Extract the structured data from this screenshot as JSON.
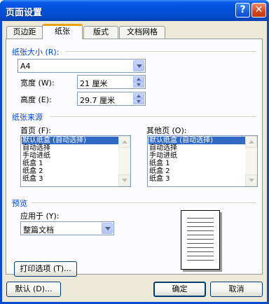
{
  "window": {
    "title": "页面设置",
    "help_glyph": "?",
    "close_glyph": "✕"
  },
  "tabs": [
    {
      "label": "页边距"
    },
    {
      "label": "纸张"
    },
    {
      "label": "版式"
    },
    {
      "label": "文档网格"
    }
  ],
  "paper_size": {
    "heading": "纸张大小 (R):",
    "selected": "A4",
    "width_label": "宽度 (W):",
    "width_value": "21 厘米",
    "height_label": "高度 (E):",
    "height_value": "29.7 厘米"
  },
  "paper_source": {
    "heading": "纸张来源",
    "first_page_label": "首页 (F):",
    "other_pages_label": "其他页 (O):",
    "options": [
      "默认纸盒 (自动选择)",
      "自动选择",
      "手动进纸",
      "纸盒 1",
      "纸盒 2",
      "纸盒 3"
    ]
  },
  "preview": {
    "heading": "预览",
    "apply_label": "应用于 (Y):",
    "apply_value": "整篇文档"
  },
  "buttons": {
    "print_options": "打印选项 (T)...",
    "default": "默认 (D)...",
    "ok": "确定",
    "cancel": "取消"
  },
  "colors": {
    "titlebar": "#0350d8",
    "dialog_bg": "#ece9d8",
    "selection": "#316ac5",
    "section_heading": "#0046d5"
  }
}
